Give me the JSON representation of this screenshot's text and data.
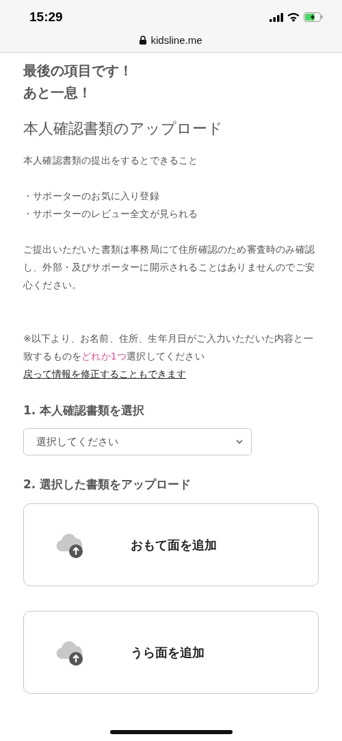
{
  "status_bar": {
    "time": "15:29"
  },
  "address_bar": {
    "url": "kidsline.me"
  },
  "headline": [
    "最後の項目です！",
    "あと一息！"
  ],
  "title": "本人確認書類のアップロード",
  "intro": "本人確認書類の提出をするとできること",
  "benefits": [
    "・サポーターのお気に入り登録",
    "・サポーターのレビュー全文が見られる"
  ],
  "privacy_note": "ご提出いただいた書類は事務局にて住所確認のため審査時のみ確認し、外部・及びサポーターに開示されることはありませんのでご安心ください。",
  "notice": {
    "before": "※以下より、お名前、住所、生年月日がご入力いただいた内容と一致するものを",
    "highlight": "どれか1つ",
    "after": "選択してください"
  },
  "back_link": "戻って情報を修正することもできます",
  "step1": {
    "label": "1. 本人確認書類を選択",
    "select": {
      "placeholder": "選択してください"
    }
  },
  "step2": {
    "label": "2. 選択した書類をアップロード",
    "uploads": [
      "おもて面を追加",
      "うら面を追加"
    ]
  }
}
